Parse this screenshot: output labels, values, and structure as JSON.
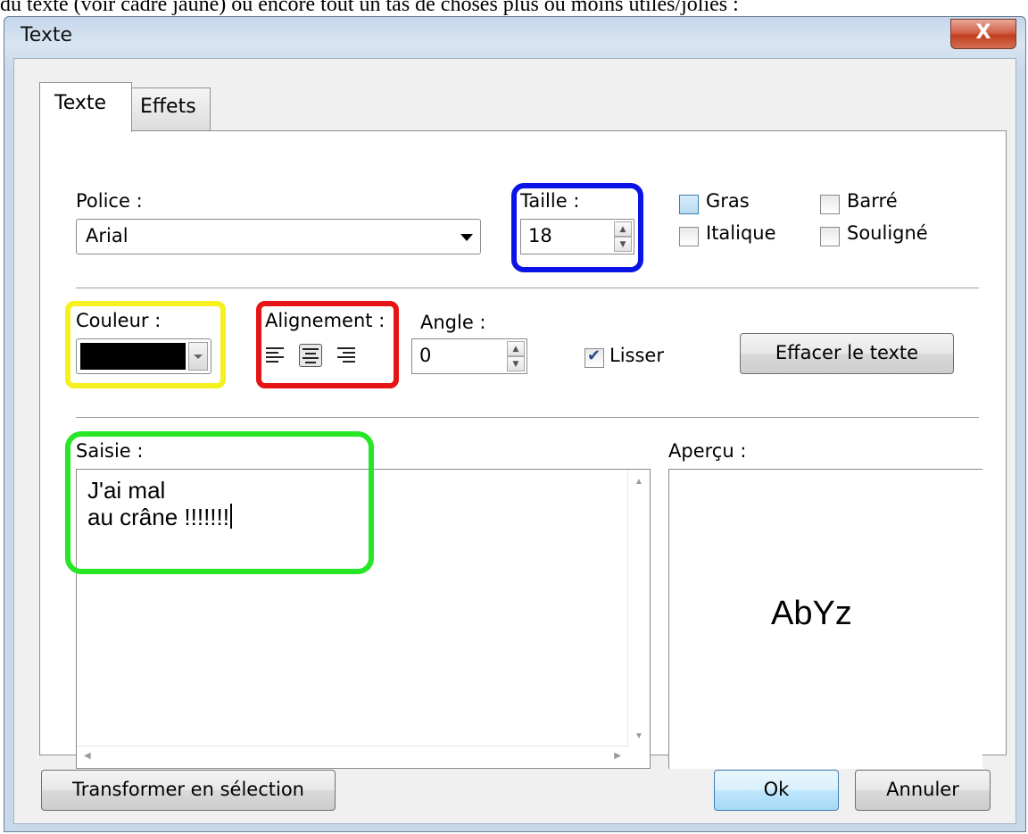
{
  "caption": "du texte (voir cadre jaune) ou encore tout un tas de choses plus ou moins utiles/jolies :",
  "window": {
    "title": "Texte",
    "close_glyph": "X"
  },
  "tabs": [
    {
      "label": "Texte",
      "active": true
    },
    {
      "label": "Effets",
      "active": false
    }
  ],
  "font": {
    "label": "Police :",
    "value": "Arial"
  },
  "size": {
    "label": "Taille :",
    "value": "18"
  },
  "style_checks": [
    {
      "label": "Gras",
      "checked": false
    },
    {
      "label": "Barré",
      "checked": false
    },
    {
      "label": "Italique",
      "checked": false
    },
    {
      "label": "Souligné",
      "checked": false
    }
  ],
  "color": {
    "label": "Couleur :",
    "value": "#000000"
  },
  "alignment": {
    "label": "Alignement :",
    "options": [
      "left",
      "center",
      "right"
    ],
    "selected": "center"
  },
  "angle": {
    "label": "Angle :",
    "value": "0"
  },
  "smooth": {
    "label": "Lisser",
    "checked": true
  },
  "clear_button": "Effacer le texte",
  "input": {
    "label": "Saisie :",
    "text": "J'ai mal\nau crâne !!!!!!!"
  },
  "preview": {
    "label": "Aperçu :",
    "sample": "AbYz"
  },
  "buttons": {
    "transform": "Transformer en sélection",
    "ok": "Ok",
    "cancel": "Annuler"
  },
  "highlight_colors": {
    "taille": "#0a14e6",
    "couleur": "#f5f01e",
    "alignement": "#e61414",
    "saisie": "#26e626"
  }
}
